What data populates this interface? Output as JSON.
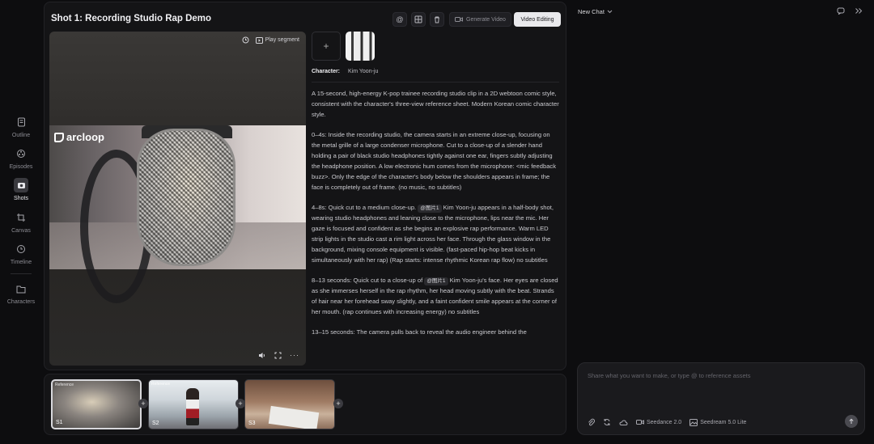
{
  "rail": {
    "items": [
      {
        "label": "Outline",
        "icon": "document-icon"
      },
      {
        "label": "Episodes",
        "icon": "film-reel-icon"
      },
      {
        "label": "Shots",
        "icon": "camera-icon"
      },
      {
        "label": "Canvas",
        "icon": "crop-icon"
      },
      {
        "label": "Timeline",
        "icon": "clock-icon"
      },
      {
        "label": "Characters",
        "icon": "folder-icon"
      }
    ],
    "active": "Shots"
  },
  "shot": {
    "title": "Shot 1: Recording Studio Rap Demo",
    "generate_video_label": "Generate Video",
    "video_editing_label": "Video Editing"
  },
  "video": {
    "logo_text": "arcloop",
    "play_segment_label": "Play segment"
  },
  "character": {
    "label": "Character:",
    "name": "Kim Yoon-ju"
  },
  "description": {
    "intro": "A 15-second, high-energy K-pop trainee recording studio clip in a 2D webtoon comic style, consistent with the character's three-view reference sheet. Modern Korean comic character style.",
    "p1": "0–4s: Inside the recording studio, the camera starts in an extreme close-up, focusing on the metal grille of a large condenser microphone. Cut to a close-up of a slender hand holding a pair of black studio headphones tightly against one ear, fingers subtly adjusting the headphone position. A low electronic hum comes from the microphone: <mic feedback buzz>. Only the edge of the character's body below the shoulders appears in frame; the face is completely out of frame. (no music, no subtitles)",
    "p2_before": "4–8s: Quick cut to a medium close-up.",
    "p2_tag": "@图片1",
    "p2_after": "Kim Yoon-ju appears in a half-body shot, wearing studio headphones and leaning close to the microphone, lips near the mic. Her gaze is focused and confident as she begins an explosive rap performance. Warm LED strip lights in the studio cast a rim light across her face. Through the glass window in the background, mixing console equipment is visible. (fast-paced hip-hop beat kicks in simultaneously with her rap) (Rap starts: intense rhythmic Korean rap flow) no subtitles",
    "p3_before": "8–13 seconds: Quick cut to a close-up of",
    "p3_tag": "@图片1",
    "p3_after": "Kim Yoon-ju's face. Her eyes are closed as she immerses herself in the rap rhythm, her head moving subtly with the beat. Strands of hair near her forehead sway slightly, and a faint confident smile appears at the corner of her mouth. (rap continues with increasing energy) no subtitles",
    "p4": "13–15 seconds: The camera pulls back to reveal the audio engineer behind the"
  },
  "timeline": {
    "clips": [
      {
        "label": "S1",
        "tag": "Reference"
      },
      {
        "label": "S2",
        "tag": "Reference"
      },
      {
        "label": "S3",
        "tag": ""
      }
    ]
  },
  "chat": {
    "title": "New Chat",
    "placeholder": "Share what you want to make, or type @ to reference assets",
    "model_video": "Seedance 2.0",
    "model_image": "Seedream 5.0 Lite"
  }
}
